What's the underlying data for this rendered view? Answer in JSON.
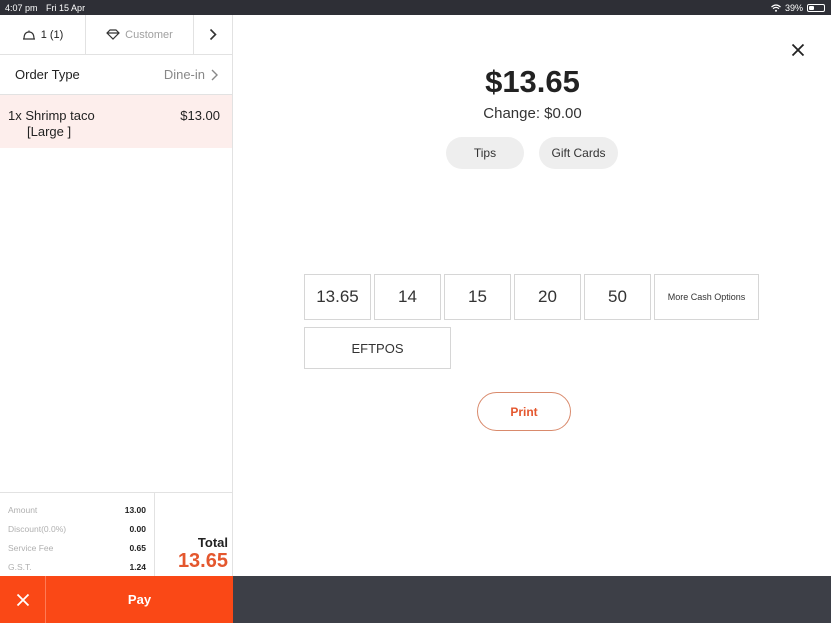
{
  "status_bar": {
    "time": "4:07 pm",
    "date": "Fri 15 Apr",
    "battery": "39%",
    "battery_level": 0.39
  },
  "left_panel": {
    "guests": "1 (1)",
    "customer_label": "Customer",
    "order_type_label": "Order Type",
    "order_type_value": "Dine-in",
    "items": [
      {
        "qty_name": "1x Shrimp taco",
        "modifier": "[Large ]",
        "price": "$13.00"
      }
    ],
    "summary": {
      "lines": [
        {
          "label": "Amount",
          "value": "13.00"
        },
        {
          "label": "Discount(0.0%)",
          "value": "0.00"
        },
        {
          "label": "Service Fee",
          "value": "0.65"
        },
        {
          "label": "G.S.T.",
          "value": "1.24"
        }
      ],
      "total_label": "Total",
      "total_value": "13.65"
    },
    "pay_label": "Pay"
  },
  "right_panel": {
    "amount": "$13.65",
    "change": "Change: $0.00",
    "tips_label": "Tips",
    "gift_cards_label": "Gift Cards",
    "cash_options": [
      "13.65",
      "14",
      "15",
      "20",
      "50"
    ],
    "more_cash_label": "More Cash Options",
    "eftpos_label": "EFTPOS",
    "print_label": "Print"
  },
  "colors": {
    "accent": "#fa4816",
    "total": "#e4572e",
    "selected_item_bg": "#fdeeec",
    "status_bar": "#2e2f36",
    "bottom_bar": "#3d3f47"
  },
  "icons": {
    "guests": "bell-icon",
    "customer": "diamond-icon",
    "expand": "chevron-right-icon",
    "close": "close-icon",
    "cancel": "close-icon"
  }
}
